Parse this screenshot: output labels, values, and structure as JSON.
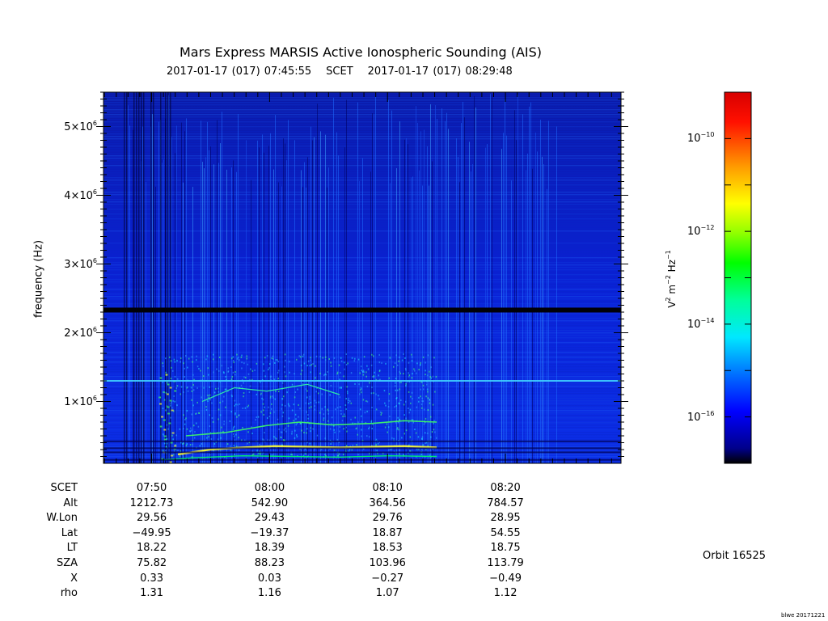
{
  "title": "Mars Express MARSIS Active Ionospheric Sounding (AIS)",
  "subtitle": {
    "start": "2017-01-17 (017) 07:45:55",
    "scet_label": "SCET",
    "end": "2017-01-17 (017) 08:29:48"
  },
  "orbit": "Orbit 16525",
  "footer_tag": "blwe 20171221",
  "chart_data": {
    "type": "heatmap",
    "title": "Mars Express MARSIS Active Ionospheric Sounding (AIS)",
    "ylabel": "frequency (Hz)",
    "ylim": [
      100000,
      5500000
    ],
    "yticks": [
      {
        "value": 1000000,
        "mantissa": "1×10",
        "exp": "6"
      },
      {
        "value": 2000000,
        "mantissa": "2×10",
        "exp": "6"
      },
      {
        "value": 3000000,
        "mantissa": "3×10",
        "exp": "6"
      },
      {
        "value": 4000000,
        "mantissa": "4×10",
        "exp": "6"
      },
      {
        "value": 5000000,
        "mantissa": "5×10",
        "exp": "6"
      }
    ],
    "xlim": [
      "07:45:55",
      "08:29:48"
    ],
    "xticks": [
      "07:50",
      "08:00",
      "08:10",
      "08:20"
    ],
    "colorbar": {
      "label": "V2 m-2 Hz-1",
      "label_parts": [
        "V",
        "2",
        " m",
        "−2",
        " Hz",
        "−1"
      ],
      "scale": "log",
      "range": [
        1e-17,
        1e-09
      ],
      "ticks": [
        {
          "mantissa": "10",
          "exp": "−10"
        },
        {
          "mantissa": "10",
          "exp": "−12"
        },
        {
          "mantissa": "10",
          "exp": "−14"
        },
        {
          "mantissa": "10",
          "exp": "−16"
        }
      ],
      "colors": [
        "#000000",
        "#0000a0",
        "#0000ff",
        "#0080ff",
        "#00ffff",
        "#00ff80",
        "#00ff00",
        "#80ff00",
        "#ffff00",
        "#ff8000",
        "#ff0000",
        "#c00000"
      ]
    },
    "features": {
      "dark_horizontal_band_hz": 2330000,
      "bright_horizontal_line_hz": 1300000,
      "background_color": "#0a1fd8"
    }
  },
  "ephemeris": {
    "labels": [
      "SCET",
      "Alt",
      "W.Lon",
      "Lat",
      "LT",
      "SZA",
      "X",
      "rho"
    ],
    "columns": [
      {
        "time": "07:50",
        "values": [
          "1212.73",
          "29.56",
          "−49.95",
          "18.22",
          "75.82",
          "0.33",
          "1.31"
        ]
      },
      {
        "time": "08:00",
        "values": [
          "542.90",
          "29.43",
          "−19.37",
          "18.39",
          "88.23",
          "0.03",
          "1.16"
        ]
      },
      {
        "time": "08:10",
        "values": [
          "364.56",
          "29.76",
          "18.87",
          "18.53",
          "103.96",
          "−0.27",
          "1.07"
        ]
      },
      {
        "time": "08:20",
        "values": [
          "784.57",
          "28.95",
          "54.55",
          "18.75",
          "113.79",
          "−0.49",
          "1.12"
        ]
      }
    ]
  }
}
